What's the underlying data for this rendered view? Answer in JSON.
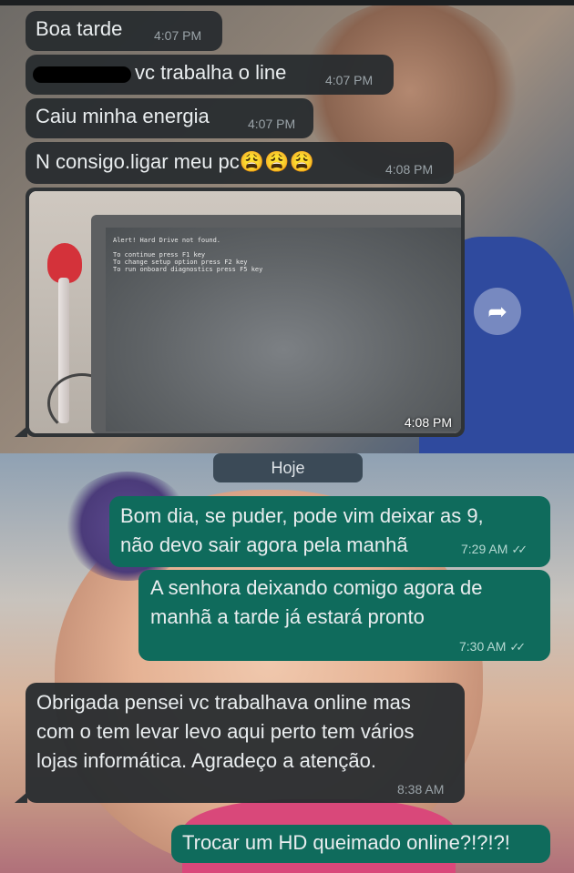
{
  "messages_incoming_1": {
    "m1": {
      "text": "Boa tarde",
      "time": "4:07 PM"
    },
    "m2": {
      "text": "vc trabalha o line",
      "time": "4:07 PM"
    },
    "m3": {
      "text": "Caiu minha energia",
      "time": "4:07 PM"
    },
    "m4": {
      "text": "N consigo.ligar meu pc😩😩😩",
      "time": "4:08 PM"
    }
  },
  "image_message": {
    "time": "4:08 PM",
    "screen_lines": [
      "Alert! Hard Drive not found.",
      "To continue press F1 key",
      "To change setup option press F2 key",
      "To run onboard diagnostics press F5 key"
    ]
  },
  "forward_icon": "forward-arrow-icon",
  "day_divider": "Hoje",
  "messages_outgoing": {
    "o1": {
      "text": "Bom dia, se puder, pode vim deixar as 9,\nnão devo sair agora pela manhã",
      "time": "7:29 AM"
    },
    "o2": {
      "text": "A senhora deixando comigo agora de\nmanhã a tarde já estará pronto",
      "time": "7:30 AM"
    },
    "o3": {
      "text": "Trocar um HD queimado online?!?!?!"
    }
  },
  "messages_incoming_2": {
    "m5": {
      "text": "Obrigada pensei vc trabalhava online mas\ncom o tem levar levo aqui perto tem vários\nlojas informática. Agradeço a atenção.",
      "time": "8:38 AM"
    }
  },
  "colors": {
    "incoming": "#2f3336",
    "outgoing": "#0f6b5c"
  }
}
